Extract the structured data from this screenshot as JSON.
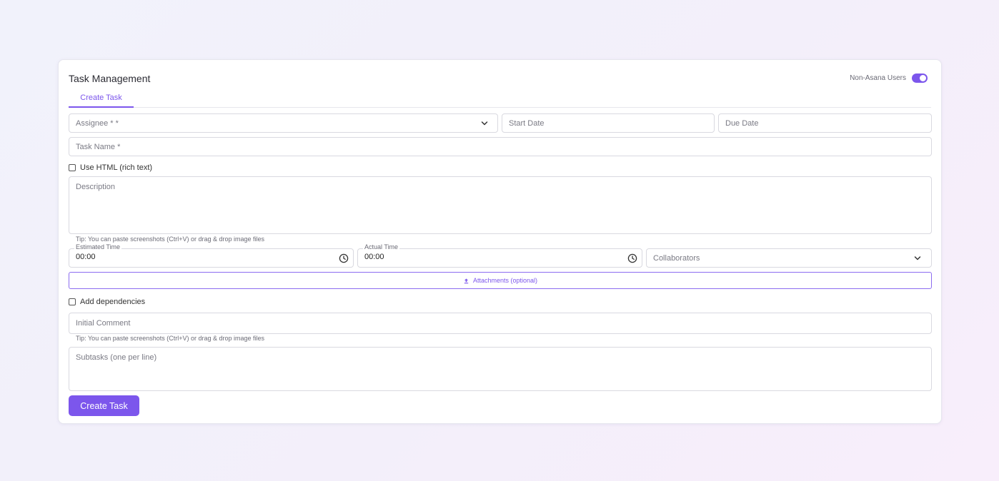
{
  "header": {
    "title": "Task Management",
    "toggle_label": "Non-Asana Users",
    "toggle_on": true
  },
  "tabs": [
    {
      "label": "Create Task",
      "active": true
    }
  ],
  "form": {
    "assignee_placeholder": "Assignee * *",
    "start_date_placeholder": "Start Date",
    "due_date_placeholder": "Due Date",
    "task_name_placeholder": "Task Name *",
    "use_html_label": "Use HTML (rich text)",
    "description_placeholder": "Description",
    "tip": "Tip: You can paste screenshots (Ctrl+V) or drag & drop image files",
    "estimated_time_label": "Estimated Time",
    "estimated_time_value": "00:00",
    "actual_time_label": "Actual Time",
    "actual_time_value": "00:00",
    "collaborators_placeholder": "Collaborators",
    "attachments_label": "Attachments (optional)",
    "add_dependencies_label": "Add dependencies",
    "initial_comment_placeholder": "Initial Comment",
    "subtasks_placeholder": "Subtasks (one per line)",
    "submit_label": "Create Task"
  },
  "colors": {
    "accent": "#7c56ec",
    "border": "#d9d9e0",
    "background_start": "#f1f2fb",
    "background_end": "#f8eefb"
  },
  "icons": {
    "dropdown": "chevron-down-icon",
    "time": "clock-icon",
    "upload": "upload-icon"
  }
}
